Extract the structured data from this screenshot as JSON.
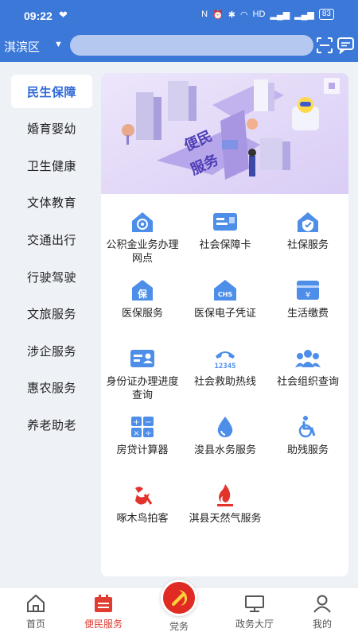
{
  "status": {
    "time": "09:22",
    "heart": "❤",
    "net": "HD",
    "signal": "⁵ᴳ",
    "battery": "83"
  },
  "topbar": {
    "district": "淇滨区",
    "search_placeholder": ""
  },
  "sidebar": {
    "items": [
      {
        "label": "民生保障",
        "active": true
      },
      {
        "label": "婚育婴幼"
      },
      {
        "label": "卫生健康"
      },
      {
        "label": "文体教育"
      },
      {
        "label": "交通出行"
      },
      {
        "label": "行驶驾驶"
      },
      {
        "label": "文旅服务"
      },
      {
        "label": "涉企服务"
      },
      {
        "label": "惠农服务"
      },
      {
        "label": "养老助老"
      }
    ]
  },
  "banner": {
    "text1": "便民",
    "text2": "服务"
  },
  "services": [
    {
      "label": "公积金业务办理网点",
      "icon": "house-coin-icon"
    },
    {
      "label": "社会保障卡",
      "icon": "id-card-icon"
    },
    {
      "label": "社保服务",
      "icon": "house-shield-icon"
    },
    {
      "label": "医保服务",
      "icon": "medical-insurance-icon"
    },
    {
      "label": "医保电子凭证",
      "icon": "chs-house-icon"
    },
    {
      "label": "生活缴费",
      "icon": "payment-icon"
    },
    {
      "label": "身份证办理进度查询",
      "icon": "identity-card-icon"
    },
    {
      "label": "社会救助热线",
      "icon": "hotline-phone-icon"
    },
    {
      "label": "社会组织查询",
      "icon": "people-group-icon"
    },
    {
      "label": "房贷计算器",
      "icon": "calculator-icon"
    },
    {
      "label": "浚县水务服务",
      "icon": "water-drop-icon"
    },
    {
      "label": "助残服务",
      "icon": "wheelchair-icon"
    },
    {
      "label": "啄木鸟拍客",
      "icon": "woodpecker-icon"
    },
    {
      "label": "淇县天然气服务",
      "icon": "gas-flame-icon"
    }
  ],
  "tabs": [
    {
      "label": "首页",
      "icon": "home-icon"
    },
    {
      "label": "便民服务",
      "icon": "calendar-icon",
      "active": true
    },
    {
      "label": "党务",
      "icon": "party-emblem-icon"
    },
    {
      "label": "政务大厅",
      "icon": "monitor-icon"
    },
    {
      "label": "我的",
      "icon": "user-icon"
    }
  ],
  "colors": {
    "brand_blue": "#3b78d8",
    "active_blue": "#2f68d8",
    "tab_active_red": "#e03c31",
    "icon_blue": "#4d8ee8",
    "icon_red": "#e2342c"
  }
}
